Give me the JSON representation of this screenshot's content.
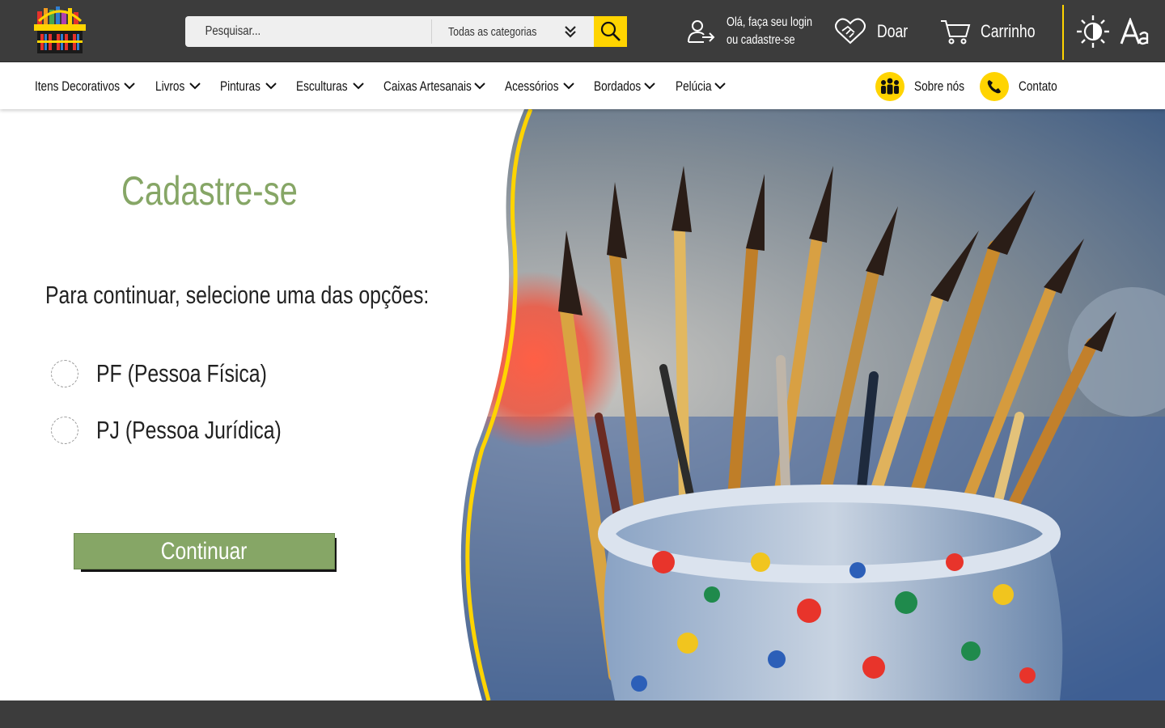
{
  "header": {
    "search": {
      "placeholder": "Pesquisar..."
    },
    "category_select": {
      "selected": "Todas as categorias"
    },
    "login": {
      "line1": "Olá, faça seu login",
      "line2": "ou cadastre-se"
    },
    "donate_label": "Doar",
    "cart_label": "Carrinho",
    "icons": [
      "logo-basket",
      "search-icon",
      "chevron-down-icon",
      "login-icon",
      "heart-handshake-icon",
      "cart-icon",
      "contrast-icon",
      "font-size-icon"
    ]
  },
  "nav": {
    "items": [
      {
        "label": "Itens Decorativos"
      },
      {
        "label": "Livros"
      },
      {
        "label": "Pinturas"
      },
      {
        "label": "Esculturas"
      },
      {
        "label": "Caixas Artesanais"
      },
      {
        "label": "Acessórios"
      },
      {
        "label": "Bordados"
      },
      {
        "label": "Pelúcia"
      }
    ],
    "about_label": "Sobre nós",
    "contact_label": "Contato"
  },
  "form": {
    "title": "Cadastre-se",
    "subtitle": "Para continuar, selecione uma das opções:",
    "options": [
      {
        "label": "PF (Pessoa  Física)",
        "selected": false
      },
      {
        "label": "PJ (Pessoa  Jurídica)",
        "selected": false
      }
    ],
    "continue_label": "Continuar"
  },
  "colors": {
    "header_bg": "#3c3c3c",
    "accent_yellow": "#ffd400",
    "brand_green": "#86a666",
    "text_dark": "#222222"
  }
}
